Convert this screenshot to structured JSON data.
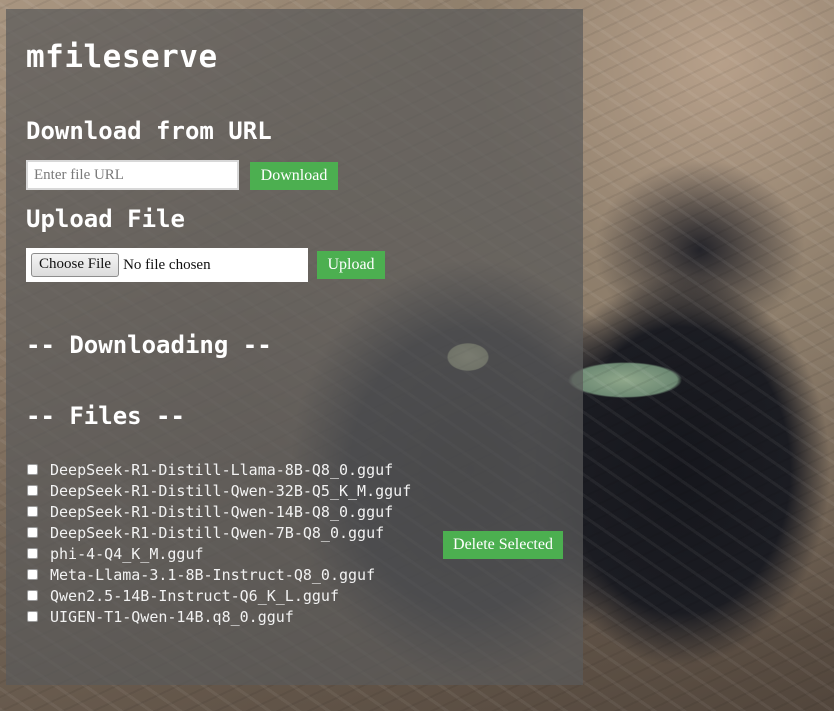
{
  "app": {
    "title": "mfileserve"
  },
  "download": {
    "heading": "Download from URL",
    "url_placeholder": "Enter file URL",
    "url_value": "",
    "button_label": "Download"
  },
  "upload": {
    "heading": "Upload File",
    "choose_label": "Choose File",
    "chosen_text": "No file chosen",
    "button_label": "Upload"
  },
  "downloading": {
    "heading": "-- Downloading --"
  },
  "files": {
    "heading": "-- Files --",
    "items": [
      "DeepSeek-R1-Distill-Llama-8B-Q8_0.gguf",
      "DeepSeek-R1-Distill-Qwen-32B-Q5_K_M.gguf",
      "DeepSeek-R1-Distill-Qwen-14B-Q8_0.gguf",
      "DeepSeek-R1-Distill-Qwen-7B-Q8_0.gguf",
      "phi-4-Q4_K_M.gguf",
      "Meta-Llama-3.1-8B-Instruct-Q8_0.gguf",
      "Qwen2.5-14B-Instruct-Q6_K_L.gguf",
      "UIGEN-T1-Qwen-14B.q8_0.gguf"
    ],
    "delete_label": "Delete Selected"
  },
  "colors": {
    "accent": "#4caf50",
    "panel": "#5a5a5a",
    "text": "#ffffff"
  },
  "background": {
    "image": "black-cat-photo"
  }
}
